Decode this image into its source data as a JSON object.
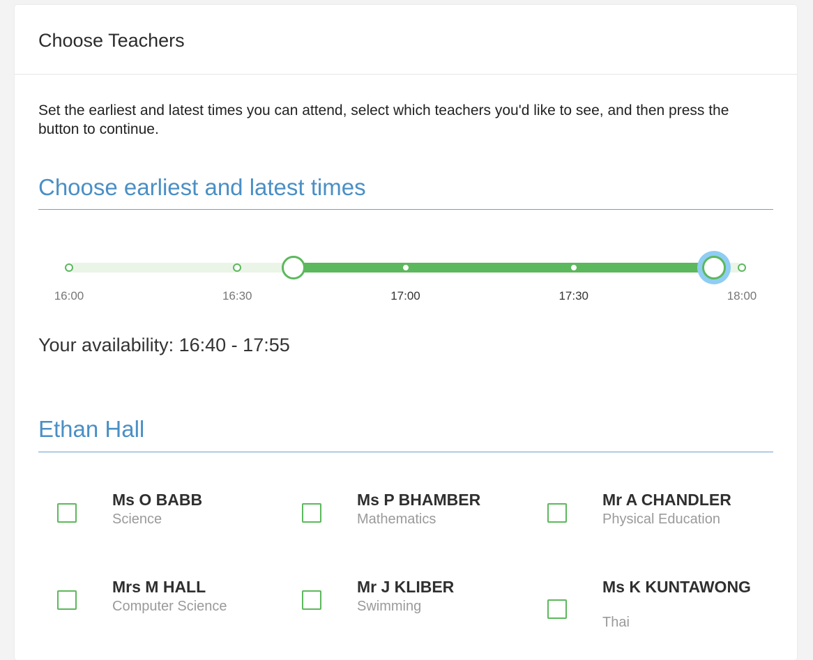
{
  "card": {
    "title": "Choose Teachers",
    "intro": "Set the earliest and latest times you can attend, select which teachers you'd like to see, and then press the button to continue."
  },
  "times_section": {
    "title": "Choose earliest and latest times",
    "slider": {
      "min": "16:00",
      "max": "18:00",
      "tick_labels": [
        "16:00",
        "16:30",
        "17:00",
        "17:30",
        "18:00"
      ],
      "earliest": "16:40",
      "latest": "17:55",
      "accent_color": "#5cb85c",
      "focus_color": "#8fcdf3"
    },
    "availability_text": "Your availability: 16:40 - 17:55"
  },
  "student_section": {
    "title": "Ethan Hall",
    "teachers": [
      {
        "name": "Ms O BABB",
        "subject": "Science",
        "checked": false
      },
      {
        "name": "Ms P BHAMBER",
        "subject": "Mathematics",
        "checked": false
      },
      {
        "name": "Mr A CHANDLER",
        "subject": "Physical Education",
        "checked": false
      },
      {
        "name": "Mrs M HALL",
        "subject": "Computer Science",
        "checked": false
      },
      {
        "name": "Mr J KLIBER",
        "subject": "Swimming",
        "checked": false
      },
      {
        "name": "Ms K KUNTAWONG",
        "subject": "Thai",
        "checked": false
      }
    ]
  },
  "colors": {
    "heading_blue": "#4a8fc5",
    "checkbox_green": "#5cb85c"
  }
}
